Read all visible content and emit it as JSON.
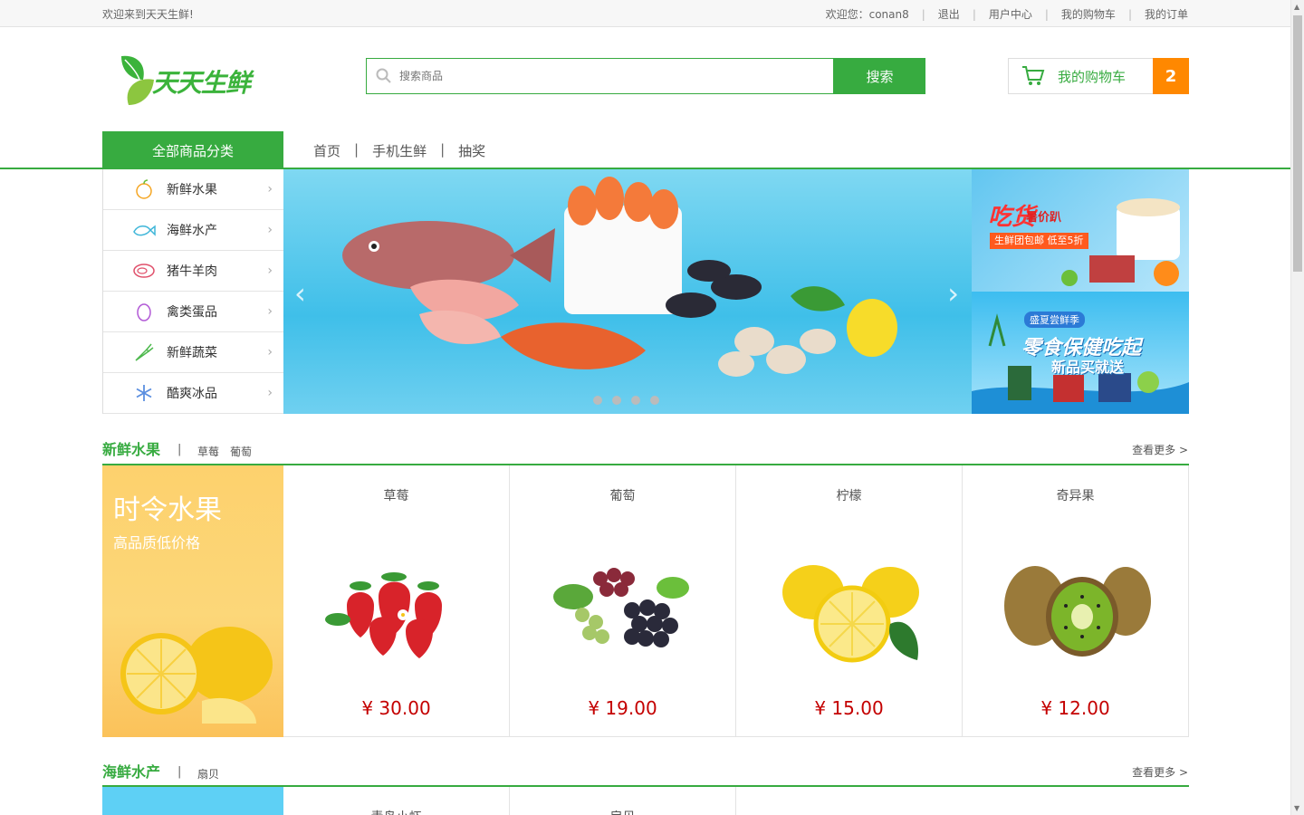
{
  "topbar": {
    "welcome": "欢迎来到天天生鲜!",
    "user_greeting": "欢迎您：conan8",
    "logout": "退出",
    "user_center": "用户中心",
    "my_cart": "我的购物车",
    "my_orders": "我的订单"
  },
  "header": {
    "logo_text": "天天生鲜",
    "search_placeholder": "搜索商品",
    "search_button": "搜索",
    "cart_label": "我的购物车",
    "cart_count": "2"
  },
  "nav": {
    "all_categories": "全部商品分类",
    "items": [
      "首页",
      "手机生鲜",
      "抽奖"
    ]
  },
  "categories": [
    {
      "label": "新鲜水果",
      "icon": "orange-icon"
    },
    {
      "label": "海鲜水产",
      "icon": "fish-icon"
    },
    {
      "label": "猪牛羊肉",
      "icon": "meat-icon"
    },
    {
      "label": "禽类蛋品",
      "icon": "egg-icon"
    },
    {
      "label": "新鲜蔬菜",
      "icon": "carrot-icon"
    },
    {
      "label": "酷爽冰品",
      "icon": "snowflake-icon"
    }
  ],
  "banner": {
    "prev": "‹",
    "next": "›",
    "dots": 4
  },
  "ads": {
    "ad1_title": "吃货",
    "ad1_subtitle": "暑价趴",
    "ad1_tag": "生鲜团包邮 低至5折",
    "ad2_tag": "盛夏尝鲜季",
    "ad2_title": "零食保健吃起",
    "ad2_subtitle": "新品买就送"
  },
  "sections": [
    {
      "title": "新鲜水果",
      "subs": [
        "草莓",
        "葡萄"
      ],
      "more": "查看更多 >",
      "promo_title": "时令水果",
      "promo_subtitle": "高品质低价格",
      "items": [
        {
          "name": "草莓",
          "price": "¥ 30.00"
        },
        {
          "name": "葡萄",
          "price": "¥ 19.00"
        },
        {
          "name": "柠檬",
          "price": "¥ 15.00"
        },
        {
          "name": "奇异果",
          "price": "¥ 12.00"
        }
      ]
    },
    {
      "title": "海鲜水产",
      "subs": [
        "扇贝"
      ],
      "more": "查看更多 >",
      "items": [
        {
          "name": "青岛小虾"
        },
        {
          "name": "扇贝"
        }
      ]
    }
  ],
  "colors": {
    "brand_green": "#37ab40",
    "cart_orange": "#ff8800",
    "price_red": "#c40000"
  }
}
